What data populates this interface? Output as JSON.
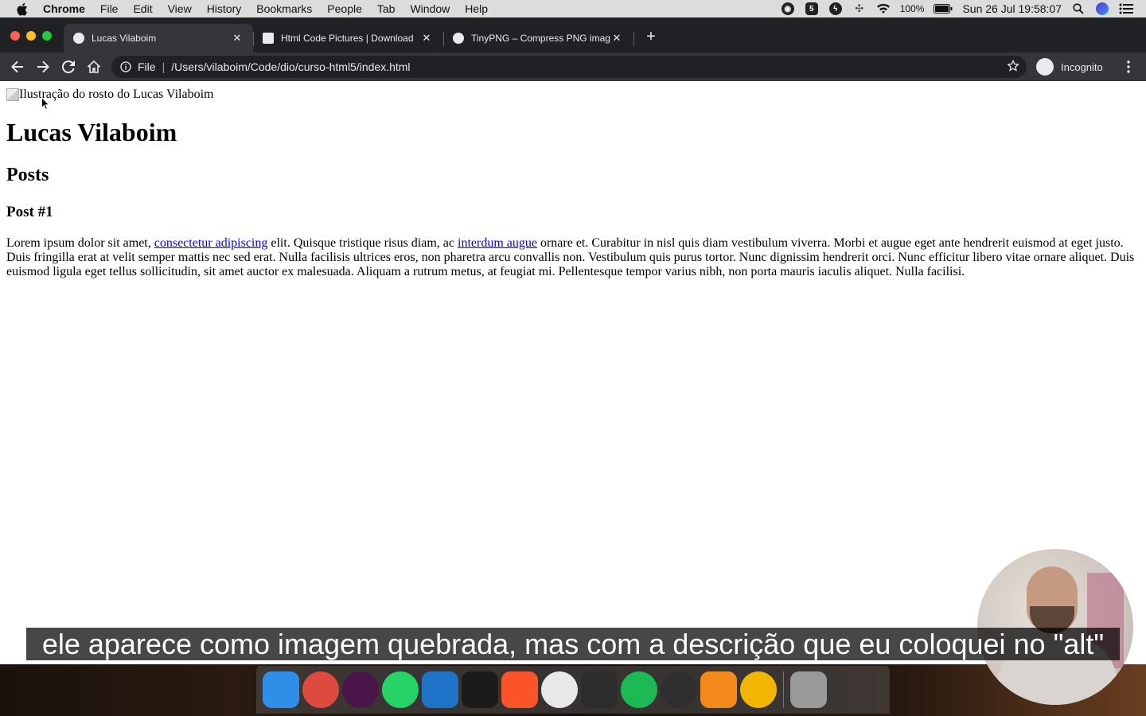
{
  "menubar": {
    "app_name": "Chrome",
    "items": [
      "File",
      "Edit",
      "View",
      "History",
      "Bookmarks",
      "People",
      "Tab",
      "Window",
      "Help"
    ],
    "battery": "100%",
    "datetime": "Sun 26 Jul  19:58:07"
  },
  "tabs": [
    {
      "title": "Lucas Vilaboim",
      "active": true
    },
    {
      "title": "Html Code Pictures | Download",
      "active": false
    },
    {
      "title": "TinyPNG – Compress PNG images",
      "active": false
    }
  ],
  "toolbar": {
    "file_label": "File",
    "url": "/Users/vilaboim/Code/dio/curso-html5/index.html",
    "incognito_label": "Incognito"
  },
  "page": {
    "img_alt": "Ilustração do rosto do Lucas Vilaboim",
    "h1": "Lucas Vilaboim",
    "h2": "Posts",
    "h3": "Post #1",
    "paragraph": {
      "part1": "Lorem ipsum dolor sit amet, ",
      "link1": "consectetur adipiscing",
      "part2": " elit. Quisque tristique risus diam, ac ",
      "link2": "interdum augue",
      "part3": " ornare et. Curabitur in nisl quis diam vestibulum viverra. Morbi et augue eget ante hendrerit euismod at eget justo. Duis fringilla erat at velit semper mattis nec sed erat. Nulla facilisis ultrices eros, non pharetra arcu convallis non. Vestibulum quis purus tortor. Nunc dignissim hendrerit orci. Nunc efficitur libero vitae ornare aliquet. Duis euismod ligula eget tellus sollicitudin, sit amet auctor ex malesuada. Aliquam a rutrum metus, at feugiat mi. Pellentesque tempor varius nibh, non porta mauris iaculis aliquet. Nulla facilisi."
    }
  },
  "subtitle": "ele aparece como imagem quebrada, mas com a descrição que eu coloquei no \"alt\"",
  "dock": [
    {
      "name": "finder-icon",
      "color": "#2f8fe8"
    },
    {
      "name": "chrome-icon",
      "color": "#dd4b3e"
    },
    {
      "name": "slack-icon",
      "color": "#4a154b"
    },
    {
      "name": "whatsapp-icon",
      "color": "#25d366"
    },
    {
      "name": "vscode-icon",
      "color": "#1e73c8"
    },
    {
      "name": "terminal-icon",
      "color": "#1b1b1b"
    },
    {
      "name": "brave-icon",
      "color": "#fb542b"
    },
    {
      "name": "browser-icon",
      "color": "#e8e8e8"
    },
    {
      "name": "figma-icon",
      "color": "#2c2c2c"
    },
    {
      "name": "spotify-icon",
      "color": "#1db954"
    },
    {
      "name": "obs-icon",
      "color": "#302e31"
    },
    {
      "name": "vlc-icon",
      "color": "#f28a1b"
    },
    {
      "name": "keeper-icon",
      "color": "#f2b500"
    },
    {
      "name": "trash-icon",
      "color": "#9a9a9a"
    }
  ]
}
